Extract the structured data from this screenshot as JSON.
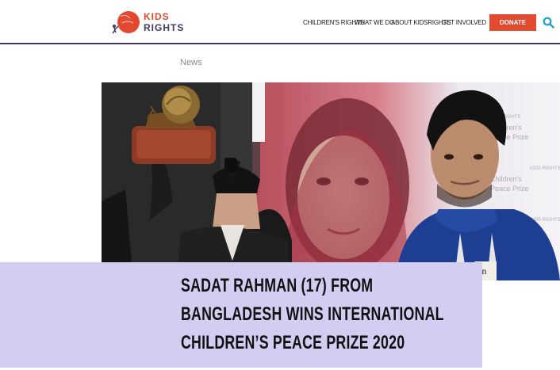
{
  "brand": {
    "line1": "KIDS",
    "line2": "RIGHTS",
    "colors": {
      "red": "#e2492f",
      "navy": "#3d3a64",
      "lavender": "#d3cdf2"
    }
  },
  "nav": {
    "items": [
      "CHILDREN'S RIGHTS",
      "WHAT WE DO",
      "ABOUT KIDSRIGHTS",
      "GET INVOLVED"
    ],
    "donate": "DONATE",
    "search_icon": "search-icon",
    "dropdown_icon": "chevron-down-icon"
  },
  "breadcrumb": "News",
  "hero": {
    "backdrop_texts": [
      "KIDS RIGHTS",
      "The International Children's Peace Prize"
    ],
    "sign_fragment": "an"
  },
  "article": {
    "title_lines": [
      "SADAT RAHMAN (17) FROM",
      "BANGLADESH WINS INTERNATIONAL",
      "CHILDREN’S PEACE PRIZE 2020"
    ]
  }
}
